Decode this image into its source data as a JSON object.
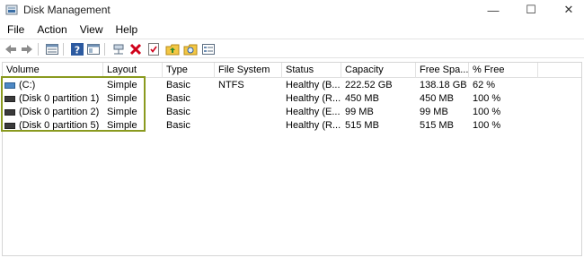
{
  "window": {
    "title": "Disk Management",
    "min_glyph": "—",
    "max_glyph": "☐",
    "close_glyph": "✕"
  },
  "menu": [
    "File",
    "Action",
    "View",
    "Help"
  ],
  "toolbar_icons": [
    "back-arrow-icon",
    "forward-arrow-icon",
    "disk-list-icon",
    "help-icon",
    "properties-icon",
    "connect-icon",
    "delete-icon",
    "check-icon",
    "up-folder-icon",
    "search-folder-icon",
    "view-icon"
  ],
  "columns": [
    "Volume",
    "Layout",
    "Type",
    "File System",
    "Status",
    "Capacity",
    "Free Spa...",
    "% Free"
  ],
  "rows": [
    {
      "volume": " (C:)",
      "layout": "Simple",
      "type": "Basic",
      "fs": "NTFS",
      "status": "Healthy (B...",
      "capacity": "222.52 GB",
      "free": "138.18 GB",
      "pct": "62 %",
      "icon": "c"
    },
    {
      "volume": "(Disk 0 partition 1)",
      "layout": "Simple",
      "type": "Basic",
      "fs": "",
      "status": "Healthy (R...",
      "capacity": "450 MB",
      "free": "450 MB",
      "pct": "100 %",
      "icon": "p"
    },
    {
      "volume": "(Disk 0 partition 2)",
      "layout": "Simple",
      "type": "Basic",
      "fs": "",
      "status": "Healthy (E...",
      "capacity": "99 MB",
      "free": "99 MB",
      "pct": "100 %",
      "icon": "p"
    },
    {
      "volume": "(Disk 0 partition 5)",
      "layout": "Simple",
      "type": "Basic",
      "fs": "",
      "status": "Healthy (R...",
      "capacity": "515 MB",
      "free": "515 MB",
      "pct": "100 %",
      "icon": "p"
    }
  ],
  "colors": {
    "highlight": "#8a9a1f",
    "delete": "#d0021b",
    "accent": "#4d88c4"
  }
}
